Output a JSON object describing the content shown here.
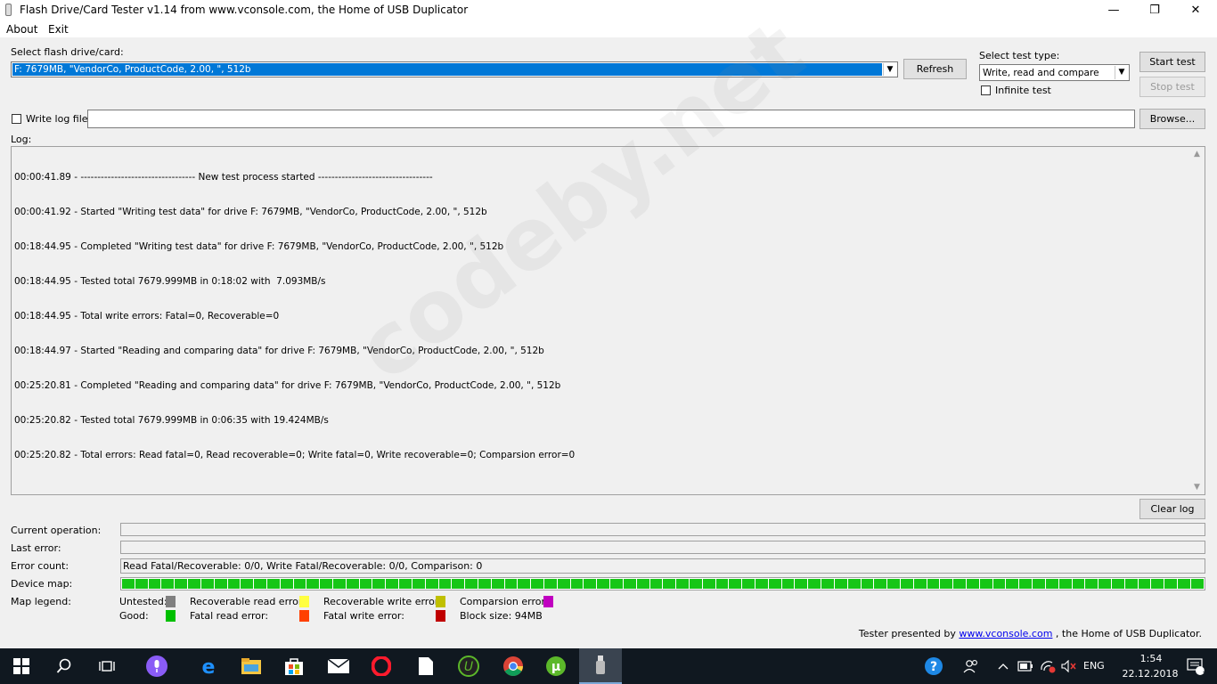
{
  "window": {
    "title": "Flash Drive/Card Tester v1.14 from www.vconsole.com, the Home of USB Duplicator",
    "minimize": "—",
    "maximize": "❐",
    "close": "✕"
  },
  "menu": {
    "about": "About",
    "exit": "Exit"
  },
  "drive": {
    "label": "Select flash drive/card:",
    "selected": "F: 7679MB, \"VendorCo, ProductCode, 2.00, \", 512b",
    "refresh_label": "Refresh"
  },
  "test": {
    "label": "Select test type:",
    "selected": "Write, read and compare",
    "infinite_label": "Infinite test",
    "start_label": "Start test",
    "stop_label": "Stop test"
  },
  "logfile": {
    "checkbox_label": "Write log file",
    "path_value": "",
    "browse_label": "Browse..."
  },
  "log": {
    "label": "Log:",
    "lines": [
      "00:00:41.89 - ---------------------------------- New test process started ----------------------------------",
      "00:00:41.92 - Started \"Writing test data\" for drive F: 7679MB, \"VendorCo, ProductCode, 2.00, \", 512b",
      "00:18:44.95 - Completed \"Writing test data\" for drive F: 7679MB, \"VendorCo, ProductCode, 2.00, \", 512b",
      "00:18:44.95 - Tested total 7679.999MB in 0:18:02 with  7.093MB/s",
      "00:18:44.95 - Total write errors: Fatal=0, Recoverable=0",
      "00:18:44.97 - Started \"Reading and comparing data\" for drive F: 7679MB, \"VendorCo, ProductCode, 2.00, \", 512b",
      "00:25:20.81 - Completed \"Reading and comparing data\" for drive F: 7679MB, \"VendorCo, ProductCode, 2.00, \", 512b",
      "00:25:20.82 - Tested total 7679.999MB in 0:06:35 with 19.424MB/s",
      "00:25:20.82 - Total errors: Read fatal=0, Read recoverable=0; Write fatal=0, Write recoverable=0; Comparsion error=0"
    ],
    "clear_label": "Clear log"
  },
  "watermark": "codeby.net",
  "status": {
    "current_operation_label": "Current operation:",
    "current_operation_value": "",
    "last_error_label": "Last error:",
    "last_error_value": "",
    "error_count_label": "Error count:",
    "error_count_value": "Read Fatal/Recoverable: 0/0, Write Fatal/Recoverable: 0/0, Comparison: 0",
    "device_map_label": "Device map:",
    "device_map_good_fraction": 1.0,
    "device_map_color": "#16c616"
  },
  "legend": {
    "label": "Map legend:",
    "untested": "Untested:",
    "good": "Good:",
    "recoverable_read": "Recoverable read error:",
    "fatal_read": "Fatal read error:",
    "recoverable_write": "Recoverable write error:",
    "fatal_write": "Fatal write error:",
    "comparsion": "Comparsion error:",
    "block_size": "Block size: 94MB",
    "colors": {
      "untested": "#808080",
      "good": "#00c000",
      "recoverable_read": "#ffff40",
      "fatal_read": "#ff4000",
      "recoverable_write": "#c0c000",
      "fatal_write": "#c00000",
      "comparsion": "#c000c0"
    }
  },
  "footer": {
    "prefix": "Tester presented by",
    "link": "www.vconsole.com",
    "suffix": ", the Home of USB Duplicator."
  },
  "taskbar": {
    "lang": "ENG",
    "time": "1:54",
    "date": "22.12.2018",
    "notification_count": "1",
    "icons": [
      "windows-start-icon",
      "search-icon",
      "task-view-icon",
      "cortana-mic-icon",
      "edge-icon",
      "file-explorer-icon",
      "store-icon",
      "mail-icon",
      "opera-icon",
      "document-icon",
      "utorrent-green-icon",
      "chrome-icon",
      "utorrent-icon",
      "flash-tester-icon"
    ]
  }
}
